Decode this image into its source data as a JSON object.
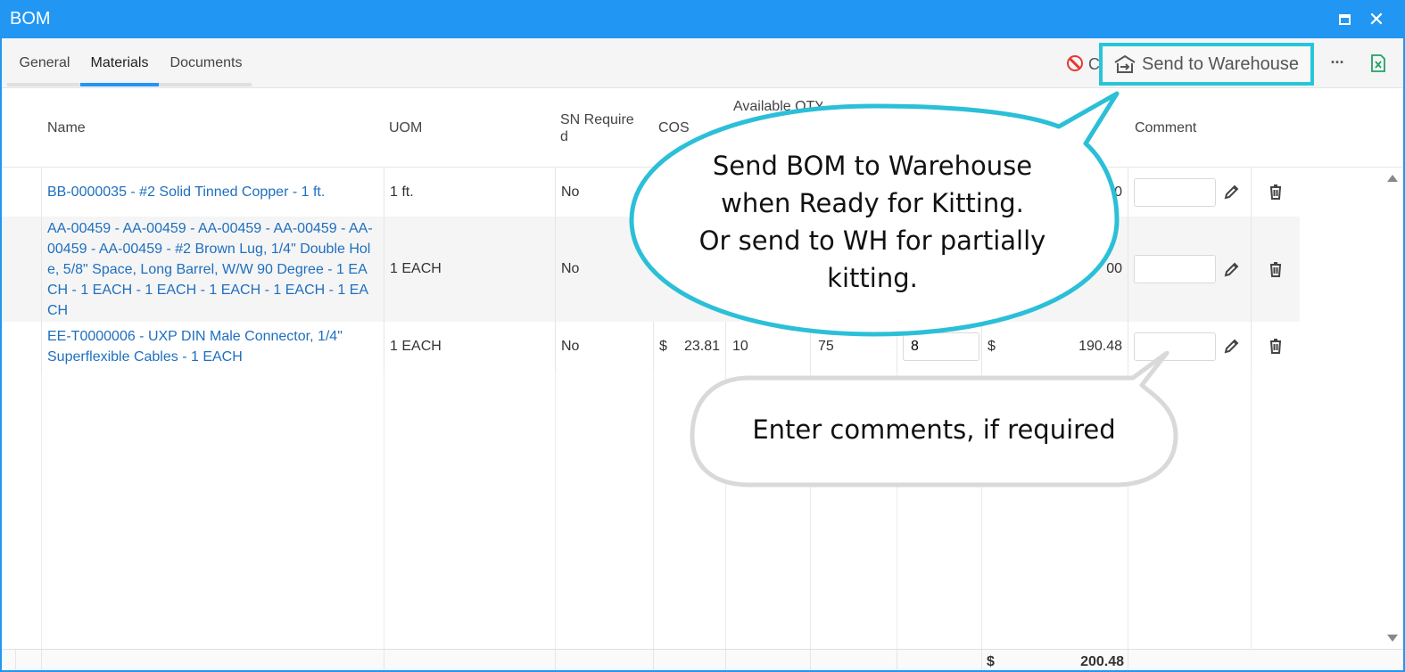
{
  "window": {
    "title": "BOM"
  },
  "tabs": [
    {
      "label": "General"
    },
    {
      "label": "Materials"
    },
    {
      "label": "Documents"
    }
  ],
  "toolbar": {
    "cancel_label": "C",
    "send_label": "Send to Warehouse",
    "more_label": "···"
  },
  "columns": {
    "name": "Name",
    "uom": "UOM",
    "sn_required": "SN Require\nd",
    "cost": "COS",
    "available_qty": "Available QTY",
    "comment": "Comment"
  },
  "rows": [
    {
      "name": "BB-0000035 - #2 Solid Tinned Copper - 1 ft.",
      "uom": "1 ft.",
      "sn_required": "No",
      "extended_tail": "0"
    },
    {
      "name": "AA-00459 - AA-00459 - AA-00459 - AA-00459 - AA-00459 - AA-00459 - #2 Brown Lug, 1/4\" Double Hole, 5/8\" Space, Long Barrel, W/W 90 Degree - 1 EACH - 1 EACH - 1 EACH - 1 EACH - 1 EACH - 1 EACH",
      "uom": "1 EACH",
      "sn_required": "No",
      "extended_tail": "00"
    },
    {
      "name": "EE-T0000006 - UXP DIN Male Connector, 1/4\" Superflexible Cables - 1 EACH",
      "uom": "1 EACH",
      "sn_required": "No",
      "cost_currency": "$",
      "cost": "23.81",
      "col_a": "10",
      "col_b": "75",
      "qty": "8",
      "ext_currency": "$",
      "extended": "190.48"
    }
  ],
  "footer": {
    "currency": "$",
    "total": "200.48"
  },
  "callouts": {
    "send_lines": [
      "Send BOM to Warehouse",
      "when Ready for Kitting.",
      "Or send to WH for partially",
      "kitting."
    ],
    "comment_text": "Enter comments, if required"
  },
  "colors": {
    "accent": "#2196f3",
    "highlight": "#26c6da",
    "link": "#1e6fc0",
    "danger": "#e53935",
    "excel": "#21a366"
  }
}
